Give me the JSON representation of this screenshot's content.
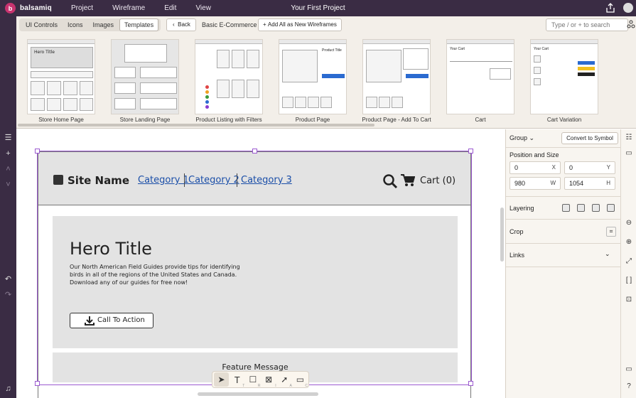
{
  "app": {
    "brand": "balsamiq",
    "menu": [
      "Project",
      "Wireframe",
      "Edit",
      "View"
    ],
    "title": "Your First Project"
  },
  "library": {
    "tabs": [
      {
        "label": "UI Controls",
        "active": false
      },
      {
        "label": "Icons",
        "active": false
      },
      {
        "label": "Images",
        "active": false
      },
      {
        "label": "Templates",
        "active": true
      }
    ],
    "back_label": "Back",
    "current": "Basic E-Commerce",
    "add_all_label": "Add All as New Wireframes",
    "search_placeholder": "Type / or + to search",
    "templates": [
      "Store Home Page",
      "Store Landing Page",
      "Product Listing with Filters",
      "Product Page",
      "Product Page - Add To Cart",
      "Cart",
      "Cart Variation"
    ],
    "thumb_text": {
      "hero": "Hero Title",
      "product_title": "Product Title",
      "cart": "Your Cart"
    }
  },
  "wireframe": {
    "site_name": "Site Name",
    "categories": [
      "Category 1",
      "Category 2",
      "Category 3"
    ],
    "cart": "Cart (0)",
    "hero_title": "Hero Title",
    "hero_text": "Our North American Field Guides provide tips for identifying birds in all of the regions of the United States and Canada. Download any of our guides for free now!",
    "cta": "Call To Action",
    "feature": "Feature Message"
  },
  "tools": [
    {
      "icon": "pointer-icon",
      "shortcut": "",
      "active": true
    },
    {
      "icon": "text-tool-icon",
      "shortcut": "T",
      "active": false
    },
    {
      "icon": "rectangle-tool-icon",
      "shortcut": "R",
      "active": false
    },
    {
      "icon": "image-placeholder-tool-icon",
      "shortcut": "I",
      "active": false
    },
    {
      "icon": "arrow-tool-icon",
      "shortcut": "A",
      "active": false
    },
    {
      "icon": "comment-tool-icon",
      "shortcut": "C",
      "active": false
    }
  ],
  "properties": {
    "group_label": "Group",
    "convert_label": "Convert to Symbol",
    "position_size_label": "Position and Size",
    "x": "0",
    "x_unit": "X",
    "y": "0",
    "y_unit": "Y",
    "w": "980",
    "w_unit": "W",
    "h": "1054",
    "h_unit": "H",
    "layering_label": "Layering",
    "crop_label": "Crop",
    "links_label": "Links"
  },
  "colors": {
    "topbar": "#3a2c44",
    "selection": "#9b59d0",
    "link": "#1a4ea8",
    "brand_logo": "#c8336f"
  }
}
